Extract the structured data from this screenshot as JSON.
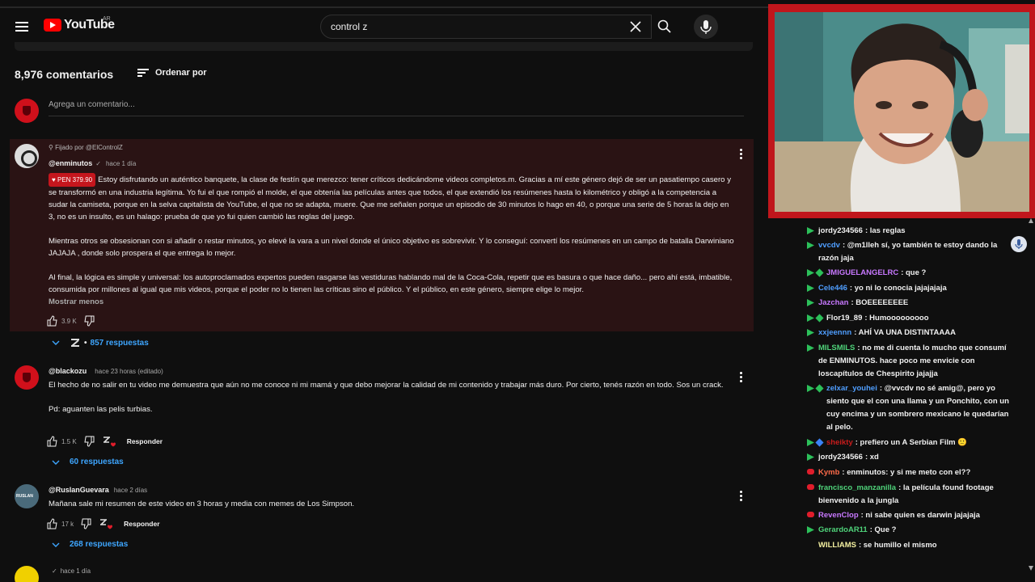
{
  "header": {
    "logo_text": "YouTube",
    "logo_region": "AR",
    "search_value": "control z"
  },
  "comments_header": {
    "count": "8,976 comentarios",
    "sort_label": "Ordenar por",
    "add_placeholder": "Agrega un comentario..."
  },
  "pinned": {
    "pin_note": "Fijado por @ElControlZ",
    "author": "@enminutos",
    "check": "✓",
    "time": "hace 1 día",
    "donation": "PEN 379.90",
    "paragraphs": [
      "Estoy disfrutando un auténtico banquete, la clase de festín que merezco: tener críticos dedicándome videos completos.m. Gracias a mí este género dejó de ser un pasatiempo casero y se transformó en una industria legítima. Yo fui el que rompió el molde, el que obtenía las películas antes que todos, el que extendió los resúmenes hasta lo kilométrico y obligó a la competencia a sudar la camiseta, porque en la selva capitalista de YouTube, el que no se adapta, muere. Que me señalen porque un episodio de 30 minutos lo hago en 40, o porque una serie de 5 horas la dejo en 3, no es un insulto, es un halago: prueba de que yo fui quien cambió las reglas del juego.",
      "Mientras otros se obsesionan con si añadir o restar minutos, yo elevé la vara a un nivel donde el único objetivo es sobrevivir. Y lo conseguí: convertí los resúmenes en un campo de batalla Darwiniano JAJAJA , donde solo prospera el que entrega lo mejor.",
      "Al final, la lógica es simple y universal: los autoproclamados expertos pueden rasgarse las vestiduras hablando mal de la Coca-Cola, repetir que es basura o que hace daño... pero ahí está, imbatible, consumida por millones al igual que mis videos, porque el poder no lo tienen las críticas sino el público. Y el público, en este género, siempre elige lo mejor."
    ],
    "show_less": "Mostrar menos",
    "likes": "3.9 K",
    "replies": "857 respuestas",
    "reply_dot": "•"
  },
  "comment2": {
    "author": "@blackozu",
    "time": "hace 23 horas (editado)",
    "paragraphs": [
      "El hecho de no salir en tu video me demuestra que aún no me conoce ni mi mamá y que debo mejorar la calidad de mi contenido y trabajar más duro. Por cierto, tenés razón en todo. Sos un crack.",
      "Pd: aguanten las pelis turbias."
    ],
    "likes": "1.5 K",
    "reply": "Responder",
    "replies": "60 respuestas"
  },
  "comment3": {
    "author": "@RuslanGuevara",
    "time": "hace 2 días",
    "text": "Mañana sale mi resumen de este video en 3 horas y media con memes de Los Simpson.",
    "likes": "17 k",
    "reply": "Responder",
    "replies": "268 respuestas"
  },
  "comment4": {
    "check": "✓",
    "time": "hace 1 día"
  },
  "chat": {
    "messages": [
      {
        "user": "jordy234566",
        "text": ": las reglas",
        "color": "#f1f1f1",
        "badge": "green"
      },
      {
        "user": "vvcdv",
        "text": ": @m1lleh sí, yo también te estoy dando la razón jaja",
        "color": "#4f9eff",
        "badge": "green"
      },
      {
        "user": "JMIGUELANGELRC",
        "text": ": que ?",
        "color": "#c878ff",
        "badge": "green-diamond"
      },
      {
        "user": "Cele446",
        "text": ": yo ni lo conocia jajajajaja",
        "color": "#4f9eff",
        "badge": "green"
      },
      {
        "user": "Jazchan",
        "text": ": BOEEEEEEEE",
        "color": "#c878ff",
        "badge": "green"
      },
      {
        "user": "Flor19_89",
        "text": ": Humooooooooo",
        "color": "#f1f1f1",
        "badge": "green-diamond"
      },
      {
        "user": "xxjeennn",
        "text": ": AHÍ VA UNA DISTINTAAAA",
        "color": "#4f9eff",
        "badge": "green"
      },
      {
        "user": "MILSMILS",
        "text": ": no me di cuenta lo mucho que consumí de ENMINUTOS. hace poco me envicie con loscapítulos de Chespirito jajajja",
        "color": "#4fd37a",
        "badge": "green"
      },
      {
        "user": "zelxar_youhei",
        "text": ": @vvcdv no sé amig@, pero yo siento que el con una llama y un Ponchito, con un cuy encima y un sombrero mexicano le quedarían al pelo.",
        "color": "#4f9eff",
        "badge": "green-diamond"
      },
      {
        "user": "sheikty",
        "text": ": prefiero un A Serbian Film 🙂",
        "color": "#c91c1c",
        "badge": "green-blue"
      },
      {
        "user": "jordy234566",
        "text": ": xd",
        "color": "#f1f1f1",
        "badge": "green"
      },
      {
        "user": "Kymb",
        "text": ": enminutos: y si me meto con el??",
        "color": "#ff6b4a",
        "badge": "red"
      },
      {
        "user": "francisco_manzanilla",
        "text": ": la película found footage bienvenido a la jungla",
        "color": "#4fd37a",
        "badge": "red"
      },
      {
        "user": "RevenClop",
        "text": ": ni sabe quien es darwin jajajaja",
        "color": "#c878ff",
        "badge": "red"
      },
      {
        "user": "GerardoAR11",
        "text": ": Que ?",
        "color": "#4fd37a",
        "badge": "green"
      },
      {
        "user": "WILLIAMS",
        "text": ": se humillo el mismo",
        "color": "#f4f0a0",
        "badge": "none"
      }
    ]
  },
  "colors": {
    "accent_link": "#3ea6ff",
    "donation_red": "#c5161d",
    "cam_border": "#c0161c",
    "pinned_bg": "#2a1314"
  }
}
